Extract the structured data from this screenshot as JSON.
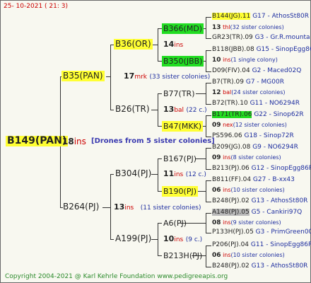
{
  "header": "25- 10-2021 ( 21: 3)",
  "root": {
    "name": "B149(PAN)",
    "count": "18",
    "tag": "ins",
    "drones": "[Drones from 5 sister colonies]"
  },
  "l1": [
    {
      "name": "B35(PAN)",
      "count": "17",
      "tag": "mrk",
      "sisters": "(33 sister colonies)"
    },
    {
      "name": "B264(PJ)",
      "count": "13",
      "tag": "ins",
      "sisters": "(11 sister colonies)"
    }
  ],
  "l2": [
    {
      "name": "B36(OR)",
      "count": "14",
      "tag": "ins",
      "sisters": ""
    },
    {
      "name": "B26(TR)",
      "count": "13",
      "tag": "bal",
      "sisters": "(22 c.)"
    },
    {
      "name": "B304(PJ)",
      "count": "11",
      "tag": "ins",
      "sisters": "(12 c.)"
    },
    {
      "name": "A199(PJ)",
      "count": "10",
      "tag": "ins",
      "sisters": "(9 c.)"
    }
  ],
  "l3": [
    "B366(MD)",
    "B350(JBB)",
    "B77(TR)",
    "B47(MKK)",
    "B167(PJ)",
    "B190(PJ)",
    "A6(PJ)",
    "B213H(PJ)"
  ],
  "l4": [
    {
      "name": "B144(JG).11",
      "info": "G17 - AthosSt80R"
    },
    {
      "name": "GR23(TR).09",
      "info": "G3 - Gr.R.mounta"
    },
    {
      "name": "B118(JBB).08",
      "info": "G15 - SinopEgg86R"
    },
    {
      "name": "D09(FIV).04",
      "info": "G2 - Maced02Q"
    },
    {
      "name": "B7(TR).09",
      "info": "G7 - MG00R"
    },
    {
      "name": "B72(TR).10",
      "info": "G11 - NO6294R"
    },
    {
      "name": "B171(TR).06",
      "info": "G22 - Sinop62R"
    },
    {
      "name": "PS596.06",
      "info": "G18 - Sinop72R"
    },
    {
      "name": "B209(JG).08",
      "info": "G9 - NO6294R"
    },
    {
      "name": "B213(PJ).06",
      "info": "G12 - SinopEgg86R"
    },
    {
      "name": "B811(FF).04",
      "info": "G27 - B-xx43"
    },
    {
      "name": "B248(PJ).02",
      "info": "G13 - AthosSt80R"
    },
    {
      "name": "A148(PJ).05",
      "info": "G5 - Cankiri97Q"
    },
    {
      "name": "P133H(PJ).05",
      "info": "G3 - PrimGreen00"
    },
    {
      "name": "P206(PJ).04",
      "info": "G11 - SinopEgg86R"
    },
    {
      "name": "B248(PJ).02",
      "info": "G13 - AthosSt80R"
    }
  ],
  "notes": [
    {
      "n": "13",
      "t": "thl",
      "s": "(32 sister colonies)"
    },
    {
      "n": "10",
      "t": "ins",
      "s": "(1 single colony)"
    },
    {
      "n": "12",
      "t": "bal",
      "s": "(24 sister colonies)"
    },
    {
      "n": "09",
      "t": "nex",
      "s": "(12 sister colonies)"
    },
    {
      "n": "09",
      "t": "ins",
      "s": "(8 sister colonies)"
    },
    {
      "n": "06",
      "t": "ins",
      "s": "(10 sister colonies)"
    },
    {
      "n": "08",
      "t": "ins",
      "s": "(9 sister colonies)"
    },
    {
      "n": "06",
      "t": "ins",
      "s": "(10 sister colonies)"
    }
  ],
  "footer": "Copyright 2004-2021 @ Karl Kehrle Foundation    www.pedigreeapis.org"
}
